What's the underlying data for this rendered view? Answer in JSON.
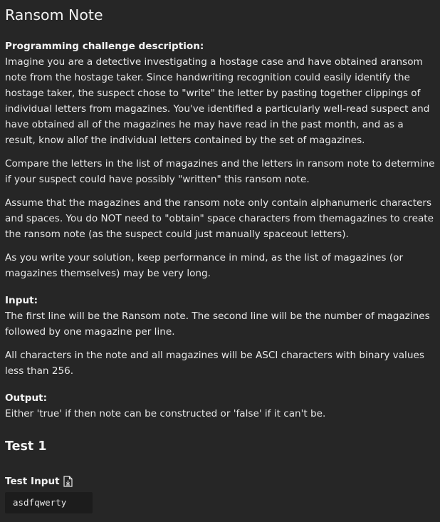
{
  "title": "Ransom Note",
  "description": {
    "label": "Programming challenge description:",
    "paragraphs": [
      "Imagine you are a detective investigating a hostage case and have obtained aransom note from the hostage taker. Since handwriting recognition could easily identify the hostage taker, the suspect chose to \"write\" the letter by pasting together clippings of individual letters from magazines. You've identified a particularly well-read suspect and have obtained all of the magazines he may have read in the past month, and as a result, know allof the individual letters contained by the set of magazines.",
      "Compare the letters in the list of magazines and the letters in ransom note to determine if your suspect could have possibly \"written\" this ransom note.",
      "Assume that the magazines and the ransom note only contain alphanumeric characters and spaces. You do NOT need to \"obtain\" space characters from themagazines to create the ransom note (as the suspect could just manually spaceout letters).",
      "As you write your solution, keep performance in mind, as the list of magazines (or magazines themselves) may be very long."
    ]
  },
  "input": {
    "label": "Input:",
    "paragraphs": [
      "The first line will be the Ransom note. The second line will be the number of magazines followed by one magazine per line.",
      "All characters in the note and all magazines will be ASCI characters with binary values less than 256."
    ]
  },
  "output": {
    "label": "Output:",
    "paragraphs": [
      "Either 'true' if then note can be constructed or 'false' if it can't be."
    ]
  },
  "test": {
    "heading": "Test 1",
    "input_label": "Test Input",
    "input_icon": "copy-document-icon",
    "input_value": "asdfqwerty"
  }
}
